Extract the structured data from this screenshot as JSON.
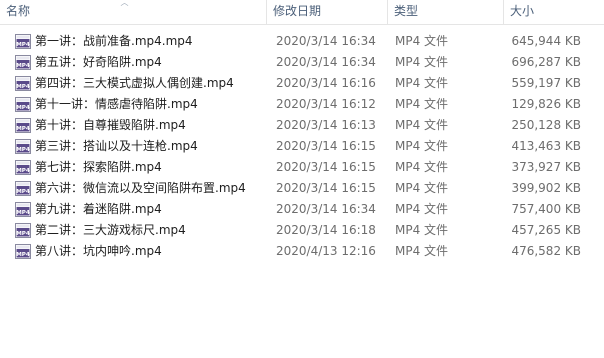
{
  "header": {
    "name": "名称",
    "date": "修改日期",
    "type": "类型",
    "size": "大小"
  },
  "files": [
    {
      "name": "第一讲：战前准备.mp4.mp4",
      "date": "2020/3/14 16:34",
      "type": "MP4 文件",
      "size": "645,944 KB"
    },
    {
      "name": "第五讲：好奇陷阱.mp4",
      "date": "2020/3/14 16:34",
      "type": "MP4 文件",
      "size": "696,287 KB"
    },
    {
      "name": "第四讲：三大模式虚拟人偶创建.mp4",
      "date": "2020/3/14 16:16",
      "type": "MP4 文件",
      "size": "559,197 KB"
    },
    {
      "name": "第十一讲：情感虐待陷阱.mp4",
      "date": "2020/3/14 16:12",
      "type": "MP4 文件",
      "size": "129,826 KB"
    },
    {
      "name": "第十讲：自尊摧毁陷阱.mp4",
      "date": "2020/3/14 16:13",
      "type": "MP4 文件",
      "size": "250,128 KB"
    },
    {
      "name": "第三讲：搭讪以及十连枪.mp4",
      "date": "2020/3/14 16:15",
      "type": "MP4 文件",
      "size": "413,463 KB"
    },
    {
      "name": "第七讲：探索陷阱.mp4",
      "date": "2020/3/14 16:15",
      "type": "MP4 文件",
      "size": "373,927 KB"
    },
    {
      "name": "第六讲：微信流以及空间陷阱布置.mp4",
      "date": "2020/3/14 16:15",
      "type": "MP4 文件",
      "size": "399,902 KB"
    },
    {
      "name": "第九讲：着迷陷阱.mp4",
      "date": "2020/3/14 16:34",
      "type": "MP4 文件",
      "size": "757,400 KB"
    },
    {
      "name": "第二讲：三大游戏标尺.mp4",
      "date": "2020/3/14 16:18",
      "type": "MP4 文件",
      "size": "457,265 KB"
    },
    {
      "name": "第八讲：坑内呻吟.mp4",
      "date": "2020/4/13 12:16",
      "type": "MP4 文件",
      "size": "476,582 KB"
    }
  ],
  "icon": {
    "name": "mp4-file-icon",
    "badge": "MP4",
    "color": "#5a4a8a"
  }
}
